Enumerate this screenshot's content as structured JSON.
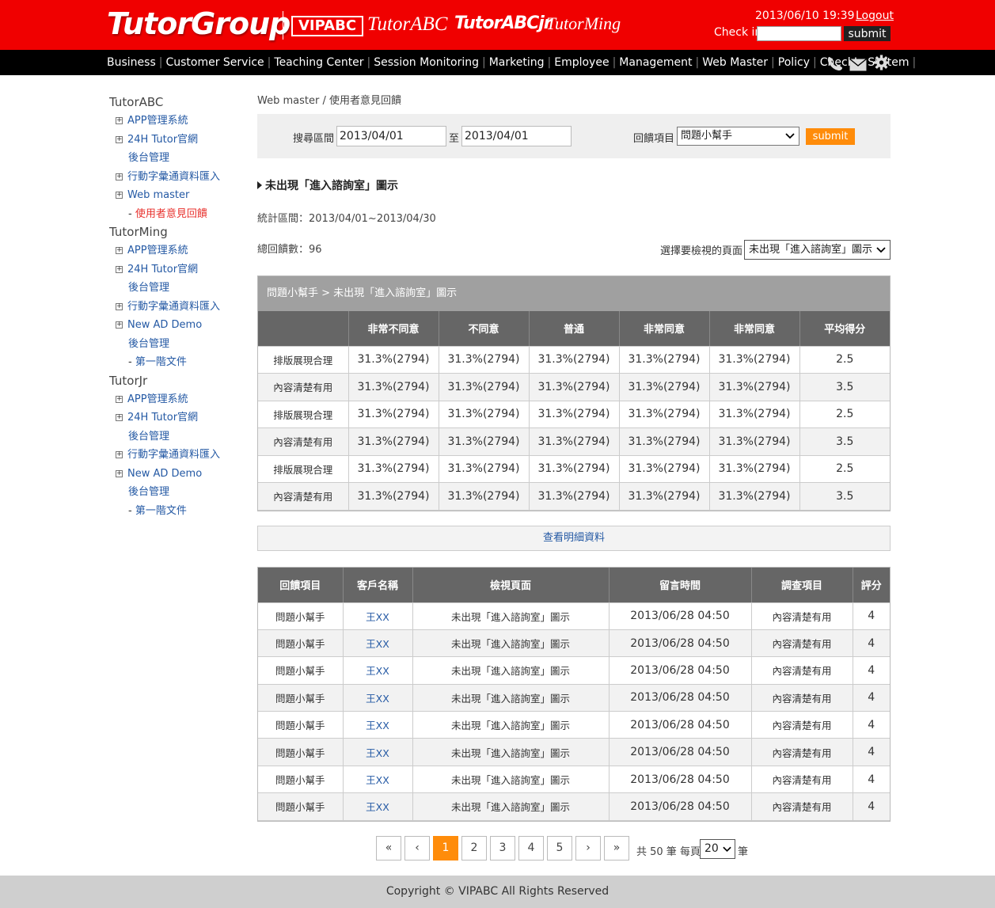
{
  "header": {
    "logo_tutorgroup": "TutorGroup",
    "logo_vipabc": "VIPABC",
    "logo_tutorabc": "TutorABC",
    "logo_tutorabcjr": "TutorABCjr",
    "logo_tutorming": "TutorMing",
    "datetime": "2013/06/10 19:39",
    "logout": "Logout",
    "checkin_label": "Check in",
    "checkin_value": "",
    "checkin_submit": "submit"
  },
  "nav": {
    "items": [
      "Business",
      "Customer Service",
      "Teaching Center",
      "Session Monitoring",
      "Marketing",
      "Employee",
      "Management",
      "Web Master",
      "Policy",
      "CheckIn System"
    ],
    "icons": [
      "phone-icon",
      "mail-icon",
      "gear-icon"
    ]
  },
  "sidebar": {
    "groups": [
      {
        "title": "TutorABC",
        "items": [
          {
            "label": "APP管理系統",
            "type": "plus"
          },
          {
            "label": "24H Tutor官網",
            "type": "plus"
          },
          {
            "label": "後台管理",
            "type": "sub"
          },
          {
            "label": "行動字彙通資料匯入",
            "type": "plus"
          },
          {
            "label": "Web master",
            "type": "plus"
          },
          {
            "label": "使用者意見回饋",
            "type": "dash",
            "active": true
          }
        ]
      },
      {
        "title": "TutorMing",
        "items": [
          {
            "label": "APP管理系統",
            "type": "plus"
          },
          {
            "label": "24H Tutor官網",
            "type": "plus"
          },
          {
            "label": "後台管理",
            "type": "sub"
          },
          {
            "label": "行動字彙通資料匯入",
            "type": "plus"
          },
          {
            "label": "New AD Demo",
            "type": "plus"
          },
          {
            "label": "後台管理",
            "type": "sub"
          },
          {
            "label": "第一階文件",
            "type": "dash"
          }
        ]
      },
      {
        "title": "TutorJr",
        "items": [
          {
            "label": "APP管理系統",
            "type": "plus"
          },
          {
            "label": "24H Tutor官網",
            "type": "plus"
          },
          {
            "label": "後台管理",
            "type": "sub"
          },
          {
            "label": "行動字彙通資料匯入",
            "type": "plus"
          },
          {
            "label": "New AD Demo",
            "type": "plus"
          },
          {
            "label": "後台管理",
            "type": "sub"
          },
          {
            "label": "第一階文件",
            "type": "dash"
          }
        ]
      }
    ]
  },
  "main": {
    "breadcrumb": "Web master / 使用者意見回饋",
    "search": {
      "range_label": "搜尋區間",
      "from": "2013/04/01",
      "to_label": "至",
      "to": "2013/04/01",
      "item_label": "回饋項目",
      "item_value": "問題小幫手",
      "submit": "submit"
    },
    "section_title": "未出現「進入諮詢室」圖示",
    "stat_range": "統計區間：2013/04/01~2013/04/30",
    "total": "總回饋數：96",
    "page_select_label": "選擇要檢視的頁面",
    "page_select_value": "未出現「進入諮詢室」圖示",
    "summary": {
      "caption": "問題小幫手 > 未出現「進入諮詢室」圖示",
      "headers": [
        "",
        "非常不同意",
        "不同意",
        "普通",
        "非常同意",
        "非常同意",
        "平均得分"
      ],
      "rows": [
        [
          "排版展現合理",
          "31.3%(2794)",
          "31.3%(2794)",
          "31.3%(2794)",
          "31.3%(2794)",
          "31.3%(2794)",
          "2.5"
        ],
        [
          "內容清楚有用",
          "31.3%(2794)",
          "31.3%(2794)",
          "31.3%(2794)",
          "31.3%(2794)",
          "31.3%(2794)",
          "3.5"
        ],
        [
          "排版展現合理",
          "31.3%(2794)",
          "31.3%(2794)",
          "31.3%(2794)",
          "31.3%(2794)",
          "31.3%(2794)",
          "2.5"
        ],
        [
          "內容清楚有用",
          "31.3%(2794)",
          "31.3%(2794)",
          "31.3%(2794)",
          "31.3%(2794)",
          "31.3%(2794)",
          "3.5"
        ],
        [
          "排版展現合理",
          "31.3%(2794)",
          "31.3%(2794)",
          "31.3%(2794)",
          "31.3%(2794)",
          "31.3%(2794)",
          "2.5"
        ],
        [
          "內容清楚有用",
          "31.3%(2794)",
          "31.3%(2794)",
          "31.3%(2794)",
          "31.3%(2794)",
          "31.3%(2794)",
          "3.5"
        ]
      ]
    },
    "detail_link": "查看明細資料",
    "detail": {
      "headers": [
        "回饋項目",
        "客戶名稱",
        "檢視頁面",
        "留言時間",
        "調查項目",
        "評分"
      ],
      "rows": [
        [
          "問題小幫手",
          "王XX",
          "未出現「進入諮詢室」圖示",
          "2013/06/28 04:50",
          "內容清楚有用",
          "4"
        ],
        [
          "問題小幫手",
          "王XX",
          "未出現「進入諮詢室」圖示",
          "2013/06/28 04:50",
          "內容清楚有用",
          "4"
        ],
        [
          "問題小幫手",
          "王XX",
          "未出現「進入諮詢室」圖示",
          "2013/06/28 04:50",
          "內容清楚有用",
          "4"
        ],
        [
          "問題小幫手",
          "王XX",
          "未出現「進入諮詢室」圖示",
          "2013/06/28 04:50",
          "內容清楚有用",
          "4"
        ],
        [
          "問題小幫手",
          "王XX",
          "未出現「進入諮詢室」圖示",
          "2013/06/28 04:50",
          "內容清楚有用",
          "4"
        ],
        [
          "問題小幫手",
          "王XX",
          "未出現「進入諮詢室」圖示",
          "2013/06/28 04:50",
          "內容清楚有用",
          "4"
        ],
        [
          "問題小幫手",
          "王XX",
          "未出現「進入諮詢室」圖示",
          "2013/06/28 04:50",
          "內容清楚有用",
          "4"
        ],
        [
          "問題小幫手",
          "王XX",
          "未出現「進入諮詢室」圖示",
          "2013/06/28 04:50",
          "內容清楚有用",
          "4"
        ]
      ]
    },
    "pager": {
      "first": "«",
      "prev": "‹",
      "pages": [
        "1",
        "2",
        "3",
        "4",
        "5"
      ],
      "current": "1",
      "next": "›",
      "last": "»",
      "total_text": "共 50 筆 每頁",
      "page_size": "20",
      "unit": "筆"
    }
  },
  "footer": {
    "copyright": "Copyright © VIPABC All Rights Reserved"
  },
  "colors": {
    "brand_red": "#f00000",
    "nav_black": "#000000",
    "accent_orange": "#ff8c0a",
    "link_blue": "#2459a4",
    "active_red": "#e8312d",
    "table_header": "#666666"
  }
}
